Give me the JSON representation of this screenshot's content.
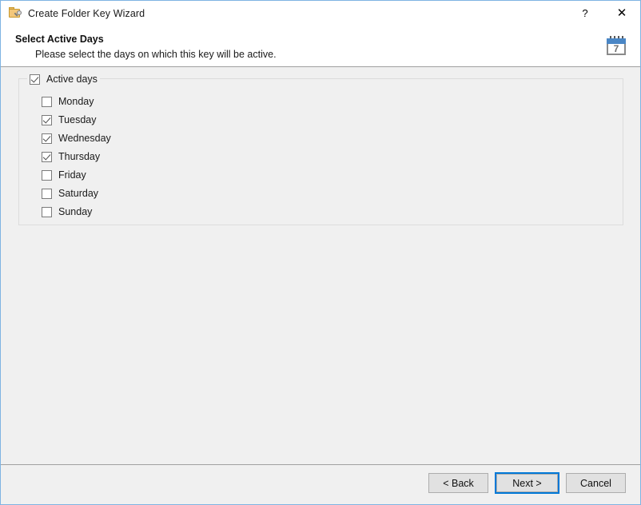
{
  "window": {
    "title": "Create Folder Key Wizard",
    "icon": "folder-key-icon",
    "accent_color": "#0078d7",
    "border_color": "#7fb4e3",
    "body_background": "#f0f0f0"
  },
  "titlebar": {
    "help_label": "?",
    "close_label": "✕"
  },
  "header": {
    "title": "Select Active Days",
    "subtitle": "Please select the days on which this key will be active.",
    "icon": "calendar-icon",
    "icon_day_number": "7",
    "icon_accent_color": "#4a86c5"
  },
  "group": {
    "legend_label": "Active days",
    "legend_checked": true,
    "days": [
      {
        "label": "Monday",
        "checked": false
      },
      {
        "label": "Tuesday",
        "checked": true
      },
      {
        "label": "Wednesday",
        "checked": true
      },
      {
        "label": "Thursday",
        "checked": true
      },
      {
        "label": "Friday",
        "checked": false
      },
      {
        "label": "Saturday",
        "checked": false
      },
      {
        "label": "Sunday",
        "checked": false
      }
    ]
  },
  "footer": {
    "back_label": "< Back",
    "next_label": "Next >",
    "cancel_label": "Cancel",
    "default_button": "Next >"
  }
}
